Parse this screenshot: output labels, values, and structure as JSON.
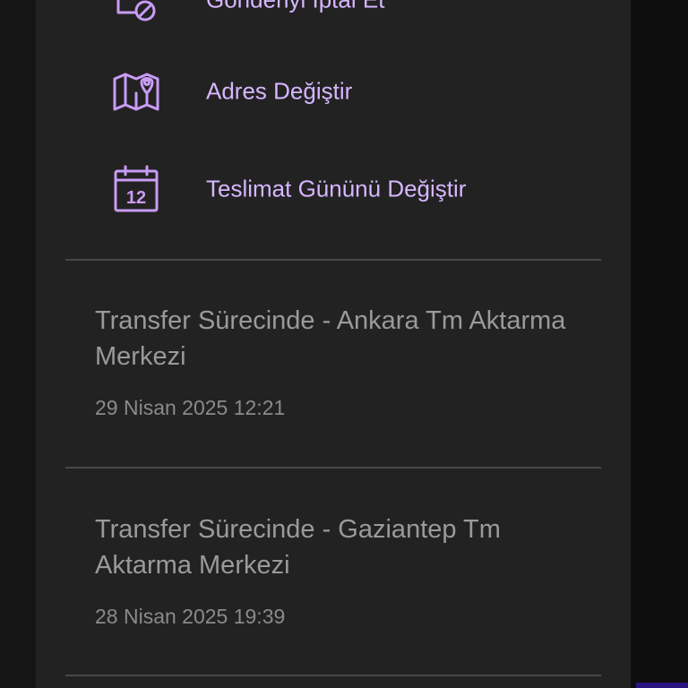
{
  "actions": [
    {
      "label": "Gönderiyi İptal Et",
      "icon": "cancel-shipment-icon"
    },
    {
      "label": "Adres Değiştir",
      "icon": "map-pin-icon"
    },
    {
      "label": "Teslimat Gününü Değiştir",
      "icon": "calendar-icon",
      "icon_text": "12"
    }
  ],
  "events": [
    {
      "title": "Transfer Sürecinde - Ankara Tm Aktarma Merkezi",
      "time": "29 Nisan 2025 12:21"
    },
    {
      "title": "Transfer Sürecinde - Gaziantep Tm Aktarma Merkezi",
      "time": "28 Nisan 2025 19:39"
    }
  ],
  "colors": {
    "accent": "#d6b6ff",
    "panel": "#222222",
    "muted_text": "#9a9a9a",
    "divider": "#484848"
  }
}
